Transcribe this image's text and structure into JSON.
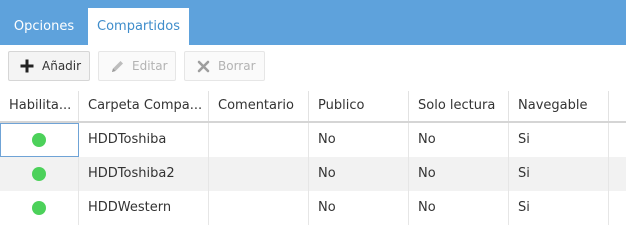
{
  "tabs": [
    {
      "label": "Opciones",
      "active": false
    },
    {
      "label": "Compartidos",
      "active": true
    }
  ],
  "toolbar": {
    "add_label": "Añadir",
    "add_icon": "plus-icon",
    "edit_label": "Editar",
    "edit_icon": "pencil-icon",
    "delete_label": "Borrar",
    "delete_icon": "x-icon"
  },
  "table": {
    "columns": [
      "Habilita...",
      "Carpeta Compa...",
      "Comentario",
      "Publico",
      "Solo lectura",
      "Navegable"
    ],
    "rows": [
      {
        "enabled": true,
        "folder": "HDDToshiba",
        "comment": "",
        "public": "No",
        "readonly": "No",
        "browsable": "Si"
      },
      {
        "enabled": true,
        "folder": "HDDToshiba2",
        "comment": "",
        "public": "No",
        "readonly": "No",
        "browsable": "Si"
      },
      {
        "enabled": true,
        "folder": "HDDWestern",
        "comment": "",
        "public": "No",
        "readonly": "No",
        "browsable": "Si"
      }
    ]
  },
  "colors": {
    "tab_bar": "#5ea2dc",
    "active_tab_text": "#3f8dcb",
    "enabled_dot": "#4cd15a"
  }
}
